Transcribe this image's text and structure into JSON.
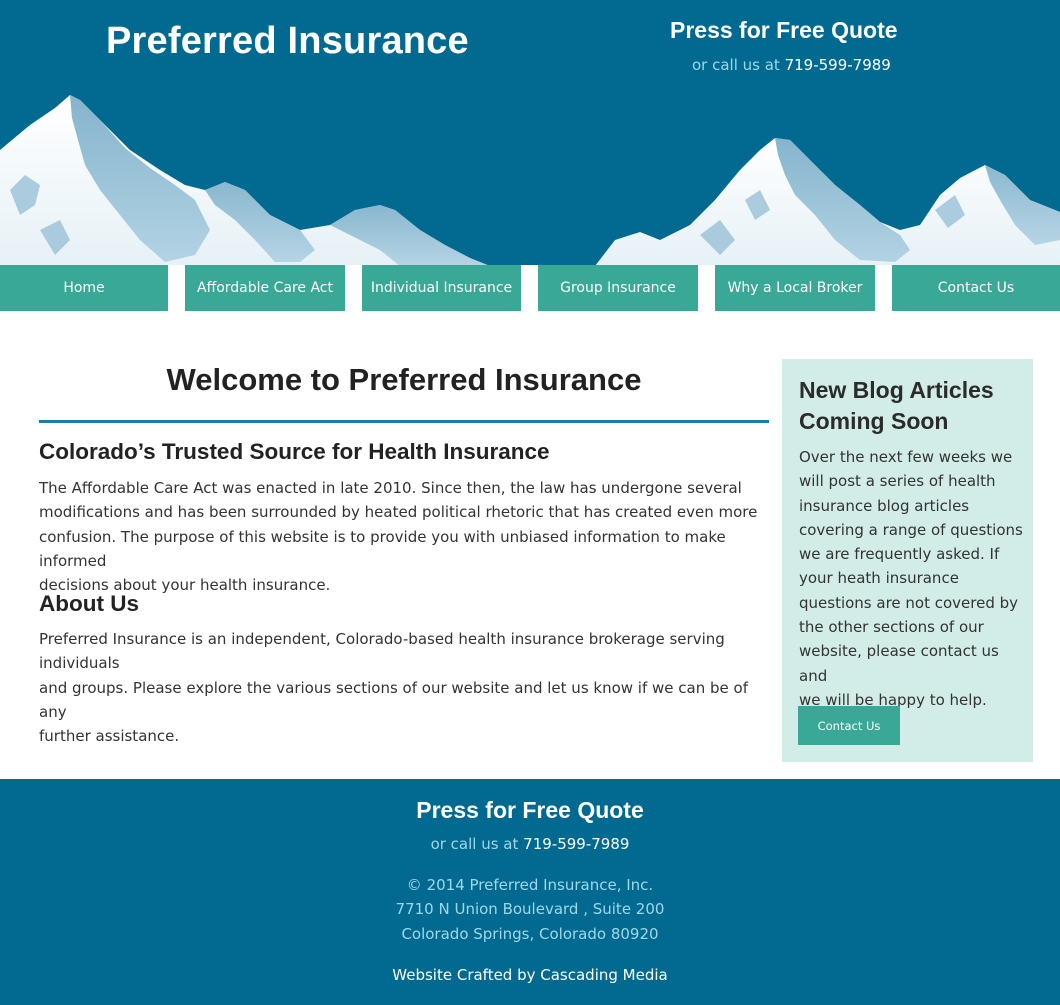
{
  "header": {
    "site_title": "Preferred Insurance",
    "quote_label": "Press for Free Quote",
    "call_prefix": "or call us at ",
    "phone": "719-599-7989"
  },
  "nav": {
    "items": [
      {
        "label": "Home"
      },
      {
        "label": "Affordable Care Act"
      },
      {
        "label": "Individual Insurance"
      },
      {
        "label": "Group Insurance"
      },
      {
        "label": "Why a Local Broker"
      },
      {
        "label": "Contact Us"
      }
    ]
  },
  "main": {
    "title": "Welcome to Preferred Insurance",
    "section1": {
      "heading": "Colorado’s Trusted Source for Health Insurance",
      "lines": [
        "The Affordable Care Act was enacted in late 2010. Since then, the law has undergone several",
        "modifications and has been surrounded by heated political rhetoric that has created even more",
        "confusion. The purpose of this website is to provide you with unbiased information to make informed",
        "decisions about your health insurance."
      ]
    },
    "section2": {
      "heading": "About Us",
      "lines": [
        "Preferred Insurance is an independent, Colorado-based health insurance brokerage serving individuals",
        "and groups. Please explore the various sections of our website and let us know if we can be of any",
        "further assistance."
      ]
    }
  },
  "sidebar": {
    "title_lines": [
      "New Blog Articles",
      "Coming Soon"
    ],
    "lines": [
      "Over the next few weeks we",
      "will post a series of health",
      "insurance blog articles",
      "covering a range of questions",
      "we are frequently asked. If",
      "your heath insurance",
      "questions are not covered by",
      "the other sections of our",
      "website, please contact us and",
      "we will be happy to help."
    ],
    "button_label": "Contact Us"
  },
  "footer": {
    "quote_label": "Press for Free Quote",
    "call_prefix": "or call us at ",
    "phone": "719-599-7989",
    "copyright": "© 2014 Preferred Insurance, Inc.",
    "address_line1": "7710 N Union Boulevard , Suite 200",
    "address_line2": "Colorado Springs, Colorado 80920",
    "credit": "Website Crafted by Cascading Media"
  },
  "colors": {
    "header_blue": "#026a90",
    "nav_teal": "#3aa896",
    "sidebar_bg": "#d2ece7",
    "accent_rule": "#1a7fa3",
    "link_light_blue": "#9fd7ea"
  }
}
